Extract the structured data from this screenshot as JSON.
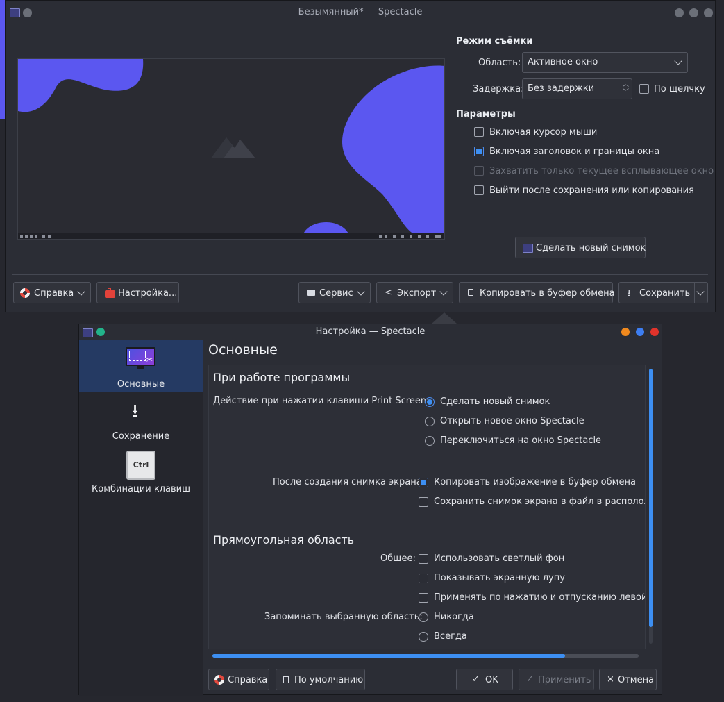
{
  "main_window": {
    "title": "Безымянный* — Spectacle",
    "capture_mode": {
      "title": "Режим съёмки",
      "area_label": "Область:",
      "area_value": "Активное окно",
      "delay_label": "Задержка:",
      "delay_value": "Без задержки",
      "on_click_label": "По щелчку"
    },
    "options": {
      "title": "Параметры",
      "items": [
        {
          "label": "Включая курсор мыши",
          "checked": false,
          "enabled": true
        },
        {
          "label": "Включая заголовок и границы окна",
          "checked": true,
          "enabled": true
        },
        {
          "label": "Захватить только текущее всплывающее окно",
          "checked": false,
          "enabled": false
        },
        {
          "label": "Выйти после сохранения или копирования",
          "checked": false,
          "enabled": true
        }
      ]
    },
    "new_screenshot_button": "Сделать новый снимок",
    "bottom_bar": {
      "help": "Справка",
      "configure": "Настройка...",
      "tools": "Сервис",
      "export": "Экспорт",
      "copy": "Копировать в буфер обмена",
      "save": "Сохранить"
    }
  },
  "settings_dialog": {
    "title": "Настройка — Spectacle",
    "sidebar": [
      {
        "label": "Основные",
        "icon": "screenshot-icon",
        "selected": true
      },
      {
        "label": "Сохранение",
        "icon": "download-icon",
        "selected": false
      },
      {
        "label": "Комбинации клавиш",
        "icon": "ctrl-key-icon",
        "selected": false
      }
    ],
    "ctrl_key_text": "Ctrl",
    "page_title": "Основные",
    "section_launch": {
      "title": "При работе программы",
      "printscreen_label": "Действие при нажатии клавиши Print Screen:",
      "printscreen_options": [
        {
          "label": "Сделать новый снимок",
          "selected": true
        },
        {
          "label": "Открыть новое окно Spectacle",
          "selected": false
        },
        {
          "label": "Переключиться на окно Spectacle",
          "selected": false
        }
      ],
      "after_label": "После создания снимка экрана:",
      "after_options": [
        {
          "label": "Копировать изображение в буфер обмена",
          "checked": true
        },
        {
          "label": "Сохранить снимок экрана в файл в  расположе",
          "checked": false
        }
      ]
    },
    "section_region": {
      "title": "Прямоугольная область",
      "general_label": "Общее:",
      "general_options": [
        {
          "label": "Использовать светлый фон",
          "checked": false
        },
        {
          "label": "Показывать экранную лупу",
          "checked": false
        },
        {
          "label": "Применять по нажатию и отпусканию левой кн",
          "checked": false
        }
      ],
      "remember_label": "Запоминать выбранную область:",
      "remember_options": [
        {
          "label": "Никогда",
          "selected": false
        },
        {
          "label": "Всегда",
          "selected": false
        }
      ]
    },
    "buttons": {
      "help": "Справка",
      "defaults": "По умолчанию",
      "ok": "OK",
      "apply": "Применить",
      "cancel": "Отмена"
    }
  },
  "colors": {
    "accent": "#3d8ff2",
    "wallpaper_blob": "#5b57f0",
    "window_bg": "#2b2d35",
    "selection": "#253a63"
  }
}
